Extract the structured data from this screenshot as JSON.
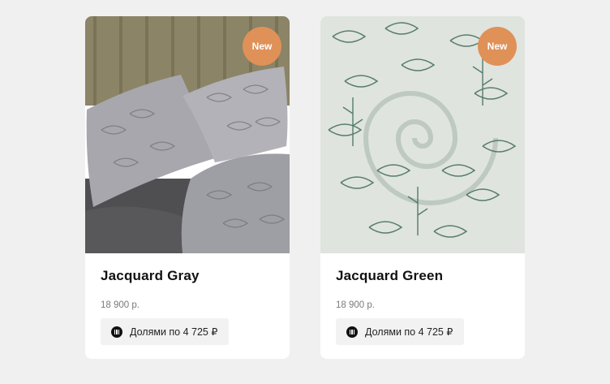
{
  "products": [
    {
      "badge": "New",
      "title": "Jacquard Gray",
      "price": "18 900 р.",
      "installment_label": "Долями по 4 725 ₽",
      "image_icon": "bedding-photo-gray"
    },
    {
      "badge": "New",
      "title": "Jacquard Green",
      "price": "18 900 р.",
      "installment_label": "Долями по 4 725 ₽",
      "image_icon": "fabric-photo-green"
    }
  ],
  "colors": {
    "background": "#f0f0f0",
    "card": "#ffffff",
    "badge": "#df9158",
    "installment_bg": "#f2f2f2"
  }
}
